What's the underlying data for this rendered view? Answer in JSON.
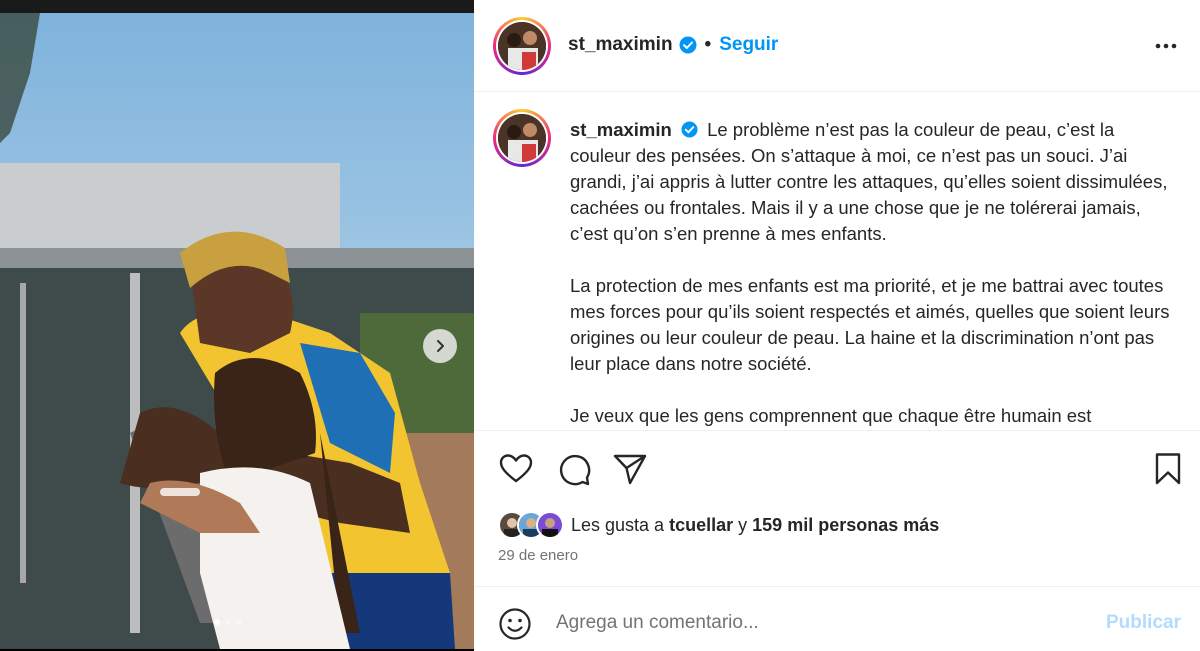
{
  "post": {
    "username": "st_maximin",
    "follow_label": "Seguir",
    "separator": "•",
    "caption_paragraphs": [
      "Le problème n’est pas la couleur de peau, c’est la couleur des pensées. On s’attaque à moi, ce n’est pas un souci. J’ai grandi, j’ai appris à lutter contre les attaques, qu’elles soient dissimulées, cachées ou frontales. Mais il y a une chose que je ne tolérerai jamais, c’est qu’on s’en prenne à mes enfants.",
      "La protection de mes enfants est ma priorité, et je me battrai avec toutes mes forces pour qu’ils soient respectés et aimés, quelles que soient leurs origines ou leur couleur de peau. La haine et la discrimination n’ont pas leur place dans notre société.",
      "Je veux que les gens comprennent que chaque être humain est"
    ],
    "likes": {
      "prefix": "Les gusta a",
      "user": "tcuellar",
      "connector": "y",
      "count": "159 mil personas más"
    },
    "date": "29 de enero"
  },
  "carousel": {
    "total_slides": 3,
    "active_slide": 1
  },
  "comment": {
    "placeholder": "Agrega un comentario...",
    "publish_label": "Publicar"
  },
  "colors": {
    "accent": "#0095f6",
    "publish_disabled": "#b3dbff",
    "verified": "#0095f6",
    "text": "#262626",
    "muted": "#737373"
  },
  "icons": {
    "more": "more-options-icon",
    "like": "heart-icon",
    "comment": "comment-icon",
    "share": "share-icon",
    "save": "bookmark-icon",
    "emoji": "emoji-icon",
    "next": "chevron-right-icon"
  }
}
